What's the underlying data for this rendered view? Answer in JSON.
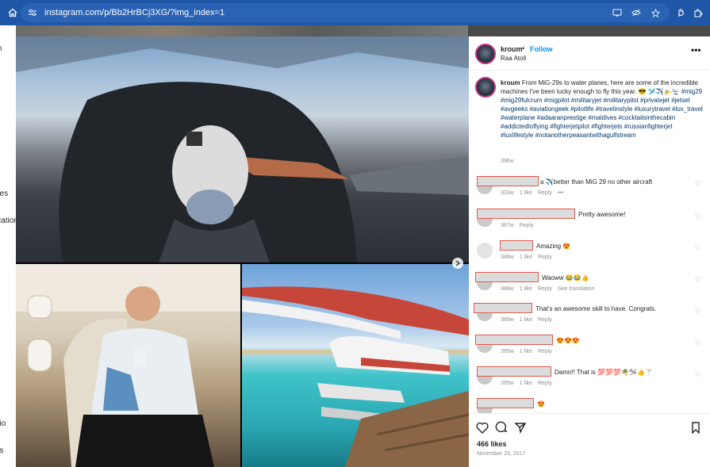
{
  "browser": {
    "url": "instagram.com/p/Bb2HrBCj3XG/?img_index=1"
  },
  "sidebar_fragments": [
    "m",
    "n",
    "e",
    "ges",
    "ication",
    "e",
    "dio",
    "ds"
  ],
  "post": {
    "username": "kroum",
    "separator": "•",
    "follow_label": "Follow",
    "location": "Raa Atoll",
    "more_label": "•••",
    "caption_text": "From MiG-29s to water planes, here are some of the incredible machines I've been lucky enough to fly this year. 😎 🛩️✈️🚁🛬",
    "caption_tags": "#mig29 #mig29fulcrum #migpilot #militaryjet #militarypilot #privatejet #jetset #avgeeks #aviationgeek #pilotlife #travelinstyle #luxurytravel #lux_travel #waterplane #adaaranprestige #maldives #cocktailsinthecabin #addictedtoflying #fighterjetpilot #fighterjets #russianfighterjet #luxlifestyle #notanotherpeasantwithagulfstream",
    "caption_time": "396w",
    "likes": "466 likes",
    "date": "November 23, 2017"
  },
  "comments": [
    {
      "text": "a ✈️better than MiG 29 no other aircraft",
      "time": "333w",
      "likes": "1 like",
      "reply": "Reply",
      "extra": "•••"
    },
    {
      "text": "Pretty awesome!",
      "time": "387w",
      "likes": "",
      "reply": "Reply",
      "extra": ""
    },
    {
      "text": "Amazing 😍",
      "time": "388w",
      "likes": "1 like",
      "reply": "Reply",
      "extra": ""
    },
    {
      "text": "Waoww 😂😂👍",
      "time": "388w",
      "likes": "1 like",
      "reply": "Reply",
      "extra": "See translation"
    },
    {
      "text": "That's an awesome skill to have. Congrats.",
      "time": "389w",
      "likes": "1 like",
      "reply": "Reply",
      "extra": ""
    },
    {
      "text": "😍😍😍",
      "time": "395w",
      "likes": "1 like",
      "reply": "Reply",
      "extra": ""
    },
    {
      "text": "Damn!! That is 💯💯💯🌴🛩👍🍸",
      "time": "395w",
      "likes": "1 like",
      "reply": "Reply",
      "extra": ""
    },
    {
      "text": "😍",
      "time": "",
      "likes": "",
      "reply": "",
      "extra": ""
    }
  ],
  "icons": {
    "home": "home-icon",
    "site_settings": "site-settings-icon",
    "screen": "cast-icon",
    "eye_off": "eye-off-icon",
    "star": "star-icon",
    "like": "heart-icon",
    "comment": "comment-icon",
    "share": "share-icon",
    "save": "bookmark-icon"
  },
  "colors": {
    "browser_bar": "#1f56a6",
    "follow": "#0095f6",
    "hashtag": "#00376b",
    "redaction_border": "#e05a4e"
  }
}
